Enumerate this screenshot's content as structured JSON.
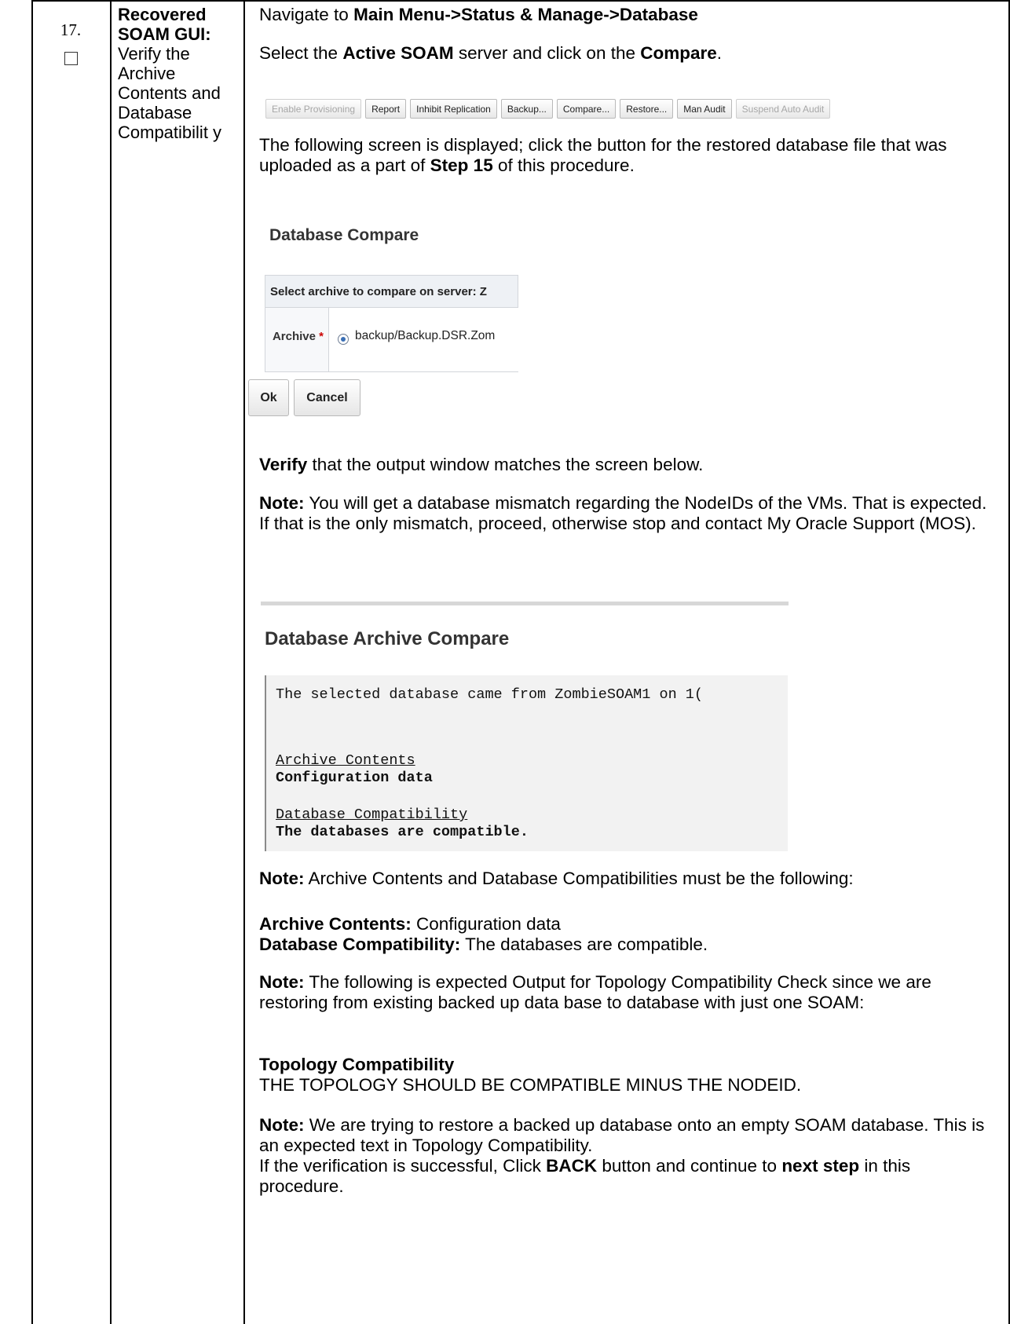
{
  "step": {
    "number": "17.",
    "title_bold": "Recovered SOAM GUI:",
    "title_rest": "Verify the Archive Contents and Database Compatibilit y"
  },
  "content": {
    "nav_prefix": "Navigate to ",
    "nav_path": "Main Menu->Status & Manage->Database",
    "select_prefix": "Select the ",
    "select_server": "Active SOAM",
    "select_mid": " server and click on the ",
    "select_button": "Compare",
    "select_end": ".",
    "screen_prefix": "The following screen is displayed; click the button for the restored database file that was uploaded as a part of ",
    "screen_step": "Step 15",
    "screen_suffix": " of this procedure.",
    "verify_bold": "Verify",
    "verify_rest": " that the output window matches the screen below.",
    "note_label": "Note:",
    "note1_text": " You will get a database mismatch regarding the NodeIDs of the VMs. That is expected. If that is the only mismatch, proceed, otherwise stop and contact My Oracle Support (MOS).",
    "note2_text": " Archive Contents and Database Compatibilities must be the following:",
    "archive_contents_label": "Archive Contents:",
    "archive_contents_value": " Configuration data",
    "db_compat_label": "Database Compatibility:",
    "db_compat_value": " The databases are compatible.",
    "note3_text": " The following is expected Output for Topology Compatibility Check since we are restoring from existing backed up data base to database with just one SOAM:",
    "topology_label": "Topology Compatibility",
    "topology_value": "THE TOPOLOGY SHOULD BE COMPATIBLE MINUS THE NODEID.",
    "note4_text": " We are trying to restore a backed up database onto an empty SOAM database. This is an expected text in Topology Compatibility.",
    "final_prefix": "If the verification is successful, Click ",
    "final_back": "BACK",
    "final_mid": " button and continue to ",
    "final_next": "next step",
    "final_suffix": " in this procedure."
  },
  "toolbar": {
    "buttons": [
      {
        "label": "Enable Provisioning",
        "enabled": false
      },
      {
        "label": "Report",
        "enabled": true
      },
      {
        "label": "Inhibit Replication",
        "enabled": true
      },
      {
        "label": "Backup...",
        "enabled": true
      },
      {
        "label": "Compare...",
        "enabled": true
      },
      {
        "label": "Restore...",
        "enabled": true
      },
      {
        "label": "Man Audit",
        "enabled": true
      },
      {
        "label": "Suspend Auto Audit",
        "enabled": false
      }
    ]
  },
  "db_compare": {
    "title": "Database Compare",
    "header": "Select archive to compare on server: Z",
    "archive_label": "Archive",
    "required_mark": "*",
    "archive_value": "backup/Backup.DSR.Zom",
    "ok_label": "Ok",
    "cancel_label": "Cancel"
  },
  "archive_compare": {
    "title": "Database Archive Compare",
    "line1": "The selected database came from ZombieSOAM1 on 1(",
    "contents_heading": "Archive Contents",
    "contents_value": "Configuration data",
    "compat_heading": "Database Compatibility",
    "compat_value": "The databases are compatible."
  }
}
